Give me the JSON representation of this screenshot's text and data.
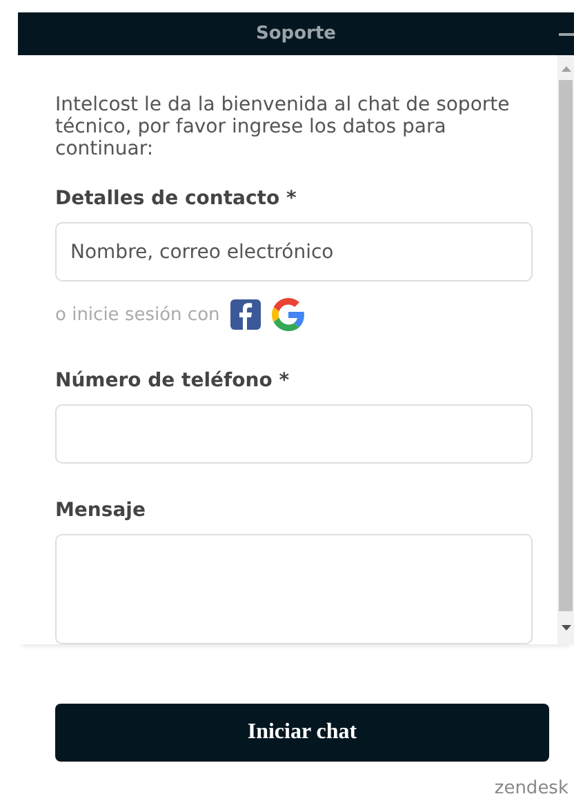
{
  "header": {
    "title": "Soporte"
  },
  "intro": "Intelcost le da la bienvenida al chat de soporte técnico, por favor ingrese los datos para continuar:",
  "fields": [
    {
      "kind": "input",
      "label": "Detalles de contacto *",
      "placeholder": "Nombre, correo electrónico"
    },
    {
      "kind": "social",
      "text": "o inicie sesión con"
    },
    {
      "kind": "input",
      "label": "Número de teléfono *"
    },
    {
      "kind": "textarea",
      "label": "Mensaje"
    }
  ],
  "button": "Iniciar chat",
  "brand": "zendesk"
}
